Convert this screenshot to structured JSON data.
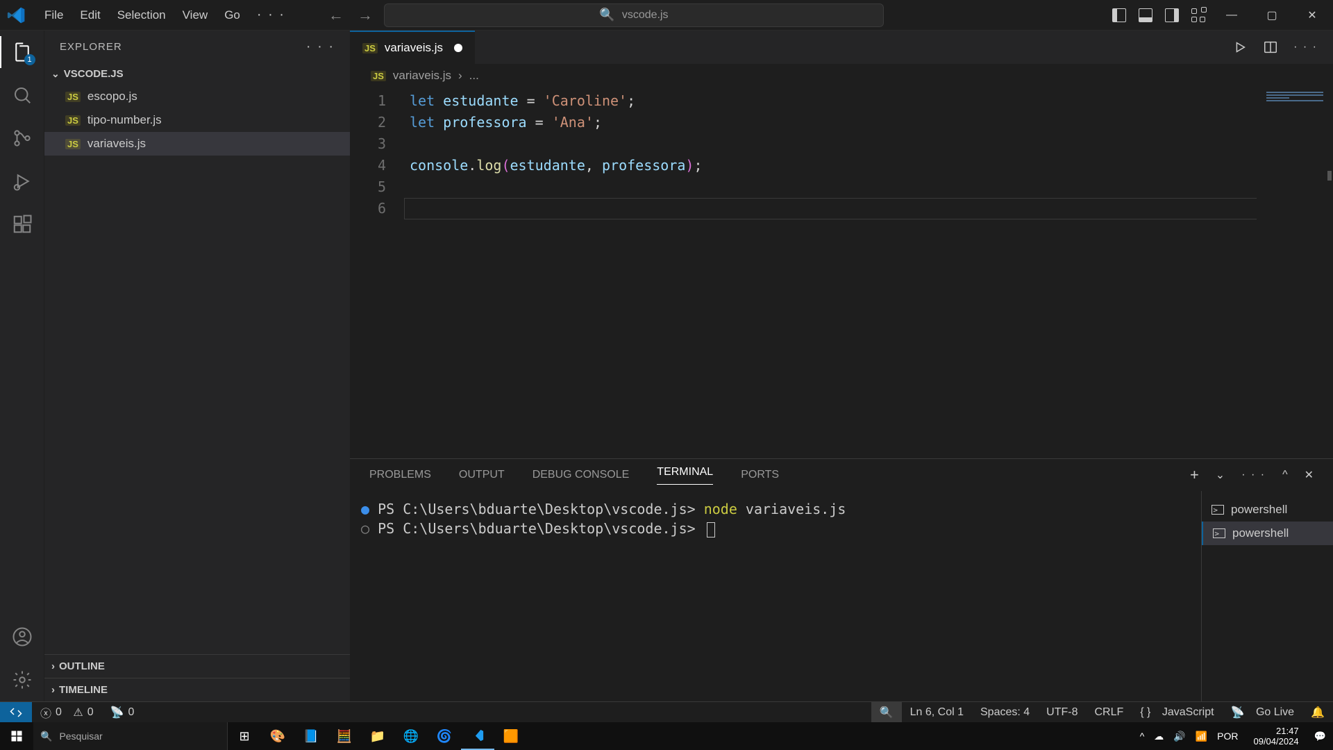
{
  "menu": {
    "file": "File",
    "edit": "Edit",
    "selection": "Selection",
    "view": "View",
    "go": "Go"
  },
  "search": {
    "placeholder": "vscode.js"
  },
  "sidebar": {
    "title": "EXPLORER",
    "folder": "VSCODE.JS",
    "files": [
      "escopo.js",
      "tipo-number.js",
      "variaveis.js"
    ],
    "outline": "OUTLINE",
    "timeline": "TIMELINE"
  },
  "activity": {
    "explorer_badge": "1"
  },
  "tab": {
    "filename": "variaveis.js"
  },
  "breadcrumb": {
    "file": "variaveis.js",
    "more": "..."
  },
  "code": {
    "l1_kw": "let",
    "l1_var": "estudante",
    "l1_eq": " = ",
    "l1_str": "'Caroline'",
    "l1_end": ";",
    "l2_kw": "let",
    "l2_var": "professora",
    "l2_eq": " = ",
    "l2_str": "'Ana'",
    "l2_end": ";",
    "l3": "",
    "l4_obj": "console",
    "l4_dot": ".",
    "l4_fn": "log",
    "l4_p1": "(",
    "l4_a1": "estudante",
    "l4_c": ", ",
    "l4_a2": "professora",
    "l4_p2": ")",
    "l4_end": ";",
    "l5": "",
    "l6": ""
  },
  "line_numbers": [
    "1",
    "2",
    "3",
    "4",
    "5",
    "6"
  ],
  "panel": {
    "problems": "PROBLEMS",
    "output": "OUTPUT",
    "debug": "DEBUG CONSOLE",
    "terminal": "TERMINAL",
    "ports": "PORTS",
    "sessions": [
      "powershell",
      "powershell"
    ]
  },
  "terminal": {
    "prompt1_pre": "PS C:\\Users\\bduarte\\Desktop\\vscode.js> ",
    "prompt1_cmd": "node ",
    "prompt1_arg": "variaveis.js",
    "prompt2": "PS C:\\Users\\bduarte\\Desktop\\vscode.js> "
  },
  "status": {
    "errors": "0",
    "warnings": "0",
    "ports": "0",
    "lncol": "Ln 6, Col 1",
    "spaces": "Spaces: 4",
    "encoding": "UTF-8",
    "eol": "CRLF",
    "lang": "JavaScript",
    "golive": "Go Live"
  },
  "taskbar": {
    "search": "Pesquisar",
    "lang": "POR",
    "time": "21:47",
    "date": "09/04/2024"
  }
}
